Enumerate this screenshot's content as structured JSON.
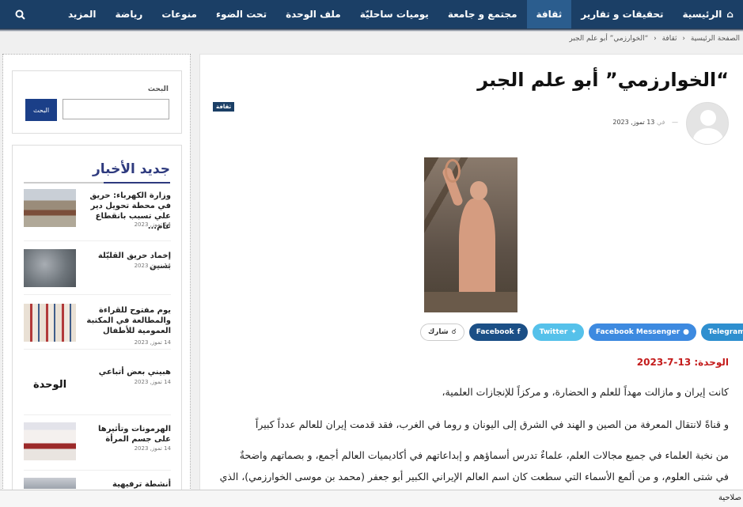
{
  "nav": {
    "items": [
      {
        "label": "الرئيسية",
        "active": false
      },
      {
        "label": "تحقيقات و تقارير",
        "active": false
      },
      {
        "label": "ثقافة",
        "active": true
      },
      {
        "label": "مجتمع و جامعة",
        "active": false
      },
      {
        "label": "يوميات ساحليّة",
        "active": false
      },
      {
        "label": "ملف الوحدة",
        "active": false
      },
      {
        "label": "تحت الضوء",
        "active": false
      },
      {
        "label": "منوعات",
        "active": false
      },
      {
        "label": "رياضة",
        "active": false
      },
      {
        "label": "المزيد",
        "active": false
      }
    ],
    "search_icon": "search-icon",
    "home_icon": "house-icon"
  },
  "breadcrumb": {
    "home": "الصفحة الرئيسية",
    "category": "ثقافة",
    "current": "“الخوارزمي” أبو علم الجبر"
  },
  "article": {
    "title": "“الخوارزمي” أبو علم الجبر",
    "category_badge": "ثقافة",
    "meta_dash": "—",
    "meta_prefix": "في",
    "meta_date": "13 تموز, 2023",
    "share_label": "شارك",
    "share_buttons": [
      "Facebook",
      "Twitter",
      "Facebook Messenger",
      "Telegram"
    ],
    "date_line": "الوحدة: 13-7-2023",
    "paragraphs": [
      "كانت إيران و مازالت مهداً للعلم و الحضارة، و مركزاً للإنجازات العلمية،",
      "و قناةً لانتقال المعرفة من الصين و الهند في الشرق إلى اليونان و روما في الغرب،  فقد قدمت إيران للعالم عدداً كبيراً",
      "من نخبة العلماء في جميع مجالات العلم، علماءٌ تدرس أسماؤهم و إبداعاتهم في أكاديميات العالم أجمع، و بصماتهم واضحةٌ",
      "في شتى العلوم، و من ألمع الأسماء التي سطعت كان اسم العالم الإيراني الكبير أبو جعفر (محمد بن موسى الخوارزمي)، الذي"
    ]
  },
  "sidebar": {
    "search_label": "البحث",
    "search_button": "البحث",
    "search_placeholder": "",
    "news_title": "جديد الأخبار",
    "news": [
      {
        "title": "وزارة الكهرباء: حريق في محطة تحويل دير علي تسبب بانقطاع عام...",
        "date": "14 تموز, 2023"
      },
      {
        "title": "إخماد حريق القليّلة بسين",
        "date": "14 تموز, 2023"
      },
      {
        "title": "يوم مفتوح للقراءة والمطالعة في المكتبة العمومية للأطفال",
        "date": "14 تموز, 2023"
      },
      {
        "title": "هبيني بعض أتباعي",
        "date": "14 تموز, 2023",
        "thumb_text": "الوحدة"
      },
      {
        "title": "الهرمونات وتأثيرها على جسم المرأة",
        "date": "14 تموز, 2023"
      },
      {
        "title": "أنشطة ترفيهية وتدريبية",
        "date": ""
      }
    ]
  },
  "footer": {
    "text": "صلاحية"
  },
  "colors": {
    "nav_bg": "#1b3f66",
    "nav_active": "#2b5d8e",
    "accent_red": "#c41c1c",
    "news_title": "#2e3a7e",
    "facebook": "#1b4f86",
    "twitter": "#55c1ea",
    "messenger": "#3d8ae0",
    "telegram": "#2e8fcf"
  }
}
